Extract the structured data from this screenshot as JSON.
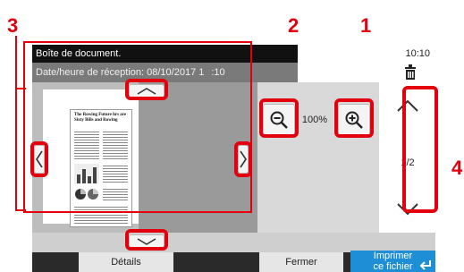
{
  "callouts": {
    "one": "1",
    "two": "2",
    "three": "3",
    "four": "4"
  },
  "header": {
    "title": "Boîte de document.",
    "time": "10:10"
  },
  "received": {
    "label": "Date/heure de réception: 08/10/2017 1",
    "time_suffix": ":10"
  },
  "document": {
    "heading": "The Rowing Future hrs are Sixty Bills and Rowing",
    "paragraph_lines": 5
  },
  "zoom": {
    "level": "100%"
  },
  "pages": {
    "indicator": "1/2"
  },
  "footer": {
    "details_label": "Détails",
    "close_label": "Fermer",
    "print_label_line1": "Imprimer",
    "print_label_line2": "ce fichier"
  },
  "icons": {
    "trash": "trash-icon",
    "zoom_out": "zoom-out-icon",
    "zoom_in": "zoom-in-icon",
    "scroll_up": "chevron-up-icon",
    "scroll_down": "chevron-down-icon",
    "page_prev": "chevron-left-icon",
    "page_next": "chevron-right-icon",
    "print_enter": "enter-arrow-icon"
  },
  "colors": {
    "callout": "#e2000f",
    "title_bar": "#111111",
    "print_button": "#1e8fd6"
  }
}
